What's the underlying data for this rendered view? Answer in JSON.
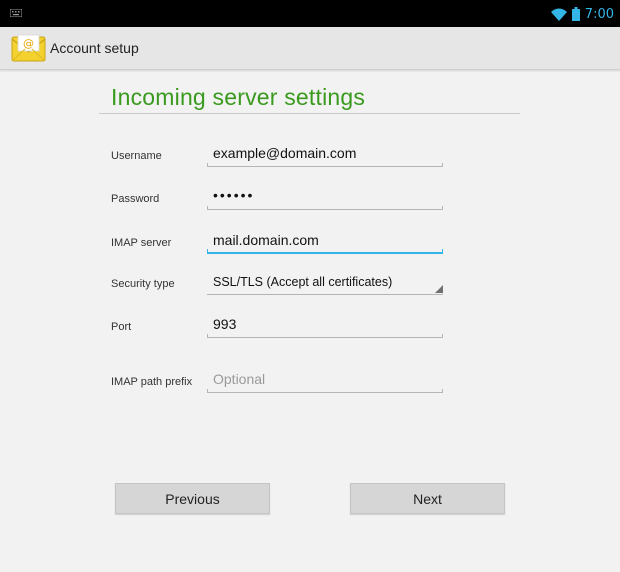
{
  "status_bar": {
    "time": "7:00",
    "icons": [
      "keyboard-icon",
      "wifi-icon",
      "battery-icon"
    ],
    "accent_color": "#33b5e5"
  },
  "action_bar": {
    "title": "Account setup",
    "icon": "email-app-icon"
  },
  "form": {
    "title": "Incoming server settings",
    "title_color": "#3a9a1e",
    "fields": {
      "username": {
        "label": "Username",
        "value": "example@domain.com"
      },
      "password": {
        "label": "Password",
        "value": "••••••"
      },
      "imap_server": {
        "label": "IMAP server",
        "value": "mail.domain.com",
        "focused": true
      },
      "security_type": {
        "label": "Security type",
        "value": "SSL/TLS (Accept all certificates)"
      },
      "port": {
        "label": "Port",
        "value": "993"
      },
      "imap_path_prefix": {
        "label": "IMAP path prefix",
        "value": "",
        "placeholder": "Optional"
      }
    }
  },
  "buttons": {
    "previous": "Previous",
    "next": "Next"
  }
}
